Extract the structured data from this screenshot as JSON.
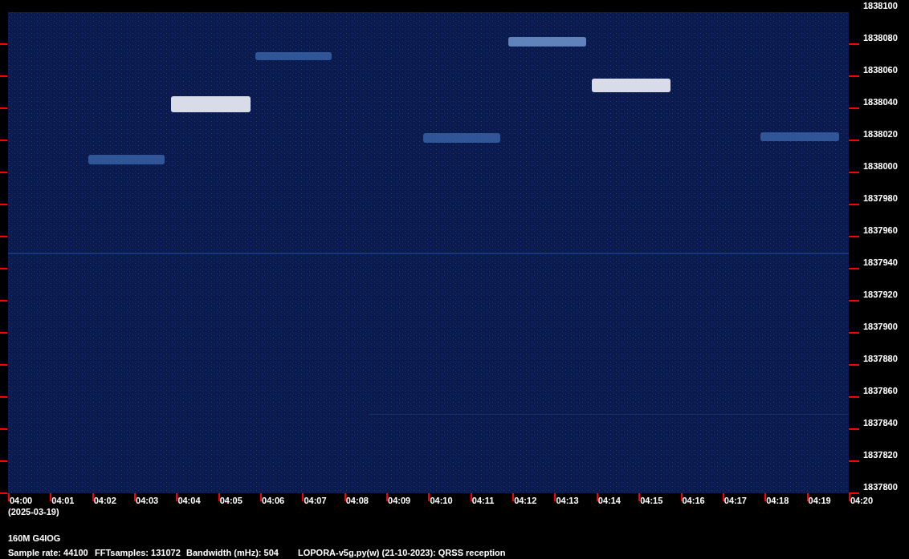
{
  "spectrogram": {
    "frequency_labels": [
      "1838100",
      "1838080",
      "1838060",
      "1838040",
      "1838020",
      "1838000",
      "1837980",
      "1837960",
      "1837940",
      "1837920",
      "1837900",
      "1837880",
      "1837860",
      "1837840",
      "1837820",
      "1837800"
    ],
    "time_labels": [
      "04:00",
      "04:01",
      "04:02",
      "04:03",
      "04:04",
      "04:05",
      "04:06",
      "04:07",
      "04:08",
      "04:09",
      "04:10",
      "04:11",
      "04:12",
      "04:13",
      "04:14",
      "04:15",
      "04:16",
      "04:17",
      "04:18",
      "04:19",
      "04:20"
    ],
    "date": "(2025-03-19)"
  },
  "footer": {
    "station": "160M G4IOG",
    "parameters": [
      "Sample rate: 44100",
      "FFTsamples: 131072",
      "Bandwidth (mHz): 504",
      "LOPORA-v5g.py(w) (21-10-2023): QRSS reception"
    ]
  }
}
